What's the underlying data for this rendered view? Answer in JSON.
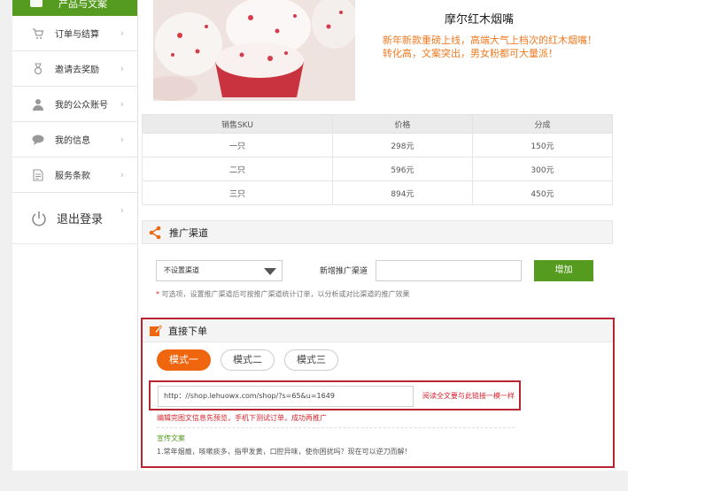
{
  "sidebar": {
    "top_item": {
      "label": "产品与文案"
    },
    "items": [
      {
        "label": "订单与结算",
        "icon": "cart-icon"
      },
      {
        "label": "邀请去奖励",
        "icon": "medal-icon"
      },
      {
        "label": "我的公众账号",
        "icon": "user-icon"
      },
      {
        "label": "我的信息",
        "icon": "chat-icon"
      },
      {
        "label": "服务条款",
        "icon": "document-icon"
      }
    ],
    "logout": {
      "label": "退出登录",
      "icon": "power-icon"
    },
    "chevron": "›"
  },
  "product": {
    "title": "摩尔红木烟嘴",
    "description_line1": "新年新款重磅上线，高端大气上档次的红木烟嘴！",
    "description_line2": "转化高，文案突出，男女粉都可大量派！"
  },
  "sku_table": {
    "headers": [
      "销售SKU",
      "价格",
      "分成"
    ],
    "rows": [
      [
        "一只",
        "298元",
        "150元"
      ],
      [
        "二只",
        "596元",
        "300元"
      ],
      [
        "三只",
        "894元",
        "450元"
      ]
    ]
  },
  "channel": {
    "section_title": "推广渠道",
    "select_value": "不设置渠道",
    "new_label": "新增推广渠道",
    "add_button": "增加",
    "note_star": "*",
    "note": "可选项，设置推广渠道后可按推广渠道统计订单，以分析或对比渠道的推广效果"
  },
  "direct_order": {
    "section_title": "直接下单",
    "modes": [
      "模式一",
      "模式二",
      "模式三"
    ],
    "url": "http：//shop.lehuowx.com/shop/?s=65&u=1649",
    "link_hint": "阅读全文要与此链接一模一样",
    "warning": "编辑完图文信息先预览，手机下测试订单，成功再推广",
    "copy_title": "宣传文案",
    "copy_text": "1.常年烟瘾，咳嗽痰多，指甲发黄，口腔异味，使你困扰吗？现在可以逆刀而解！"
  },
  "colors": {
    "accent_green": "#559b1f",
    "accent_orange": "#f0660f",
    "highlight_red": "#b8242f"
  }
}
